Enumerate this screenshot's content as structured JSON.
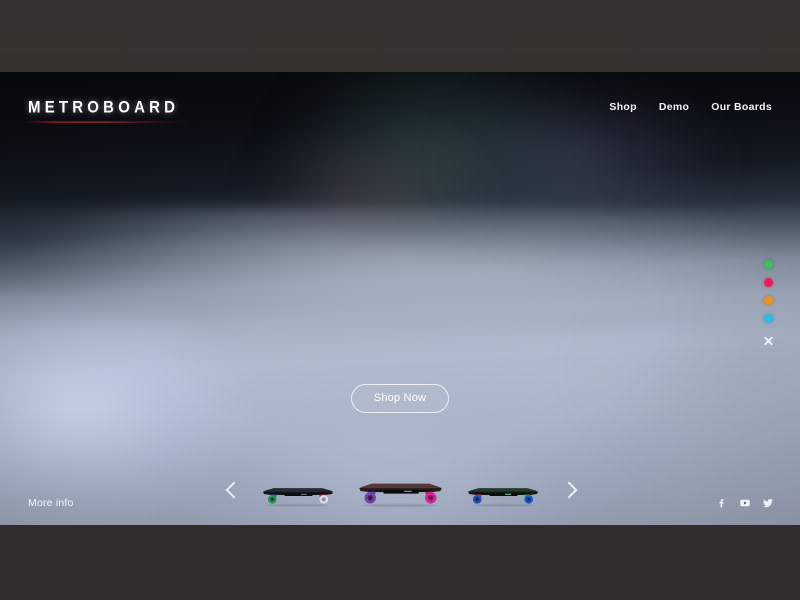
{
  "site": {
    "brand": "METROBOARD",
    "nav": [
      {
        "label": "Shop",
        "name": "nav-shop"
      },
      {
        "label": "Demo",
        "name": "nav-demo"
      },
      {
        "label": "Our Boards",
        "name": "nav-our-boards"
      }
    ],
    "hero": {
      "cta_label": "Shop Now"
    },
    "swatches": [
      {
        "name": "swatch-green",
        "color": "#3FBF5E"
      },
      {
        "name": "swatch-pink",
        "color": "#F5165B"
      },
      {
        "name": "swatch-orange",
        "color": "#F0911F"
      },
      {
        "name": "swatch-cyan",
        "color": "#29BEEA"
      }
    ],
    "close_icon": "close-icon",
    "carousel": {
      "prev_icon": "chevron-left-icon",
      "next_icon": "chevron-right-icon",
      "boards": [
        {
          "name": "board-thumb-1",
          "deck": "#14171d",
          "deck_top": "#1f242c",
          "wheel_front": "#2f8f5f",
          "wheel_rear": "#d8dde5",
          "truck_front": "#2b62b4",
          "truck_rear": "#c8233f",
          "scale": 0.82
        },
        {
          "name": "board-thumb-2",
          "deck": "#2a1d1c",
          "deck_top": "#4a3230",
          "wheel_front": "#7a3fa8",
          "wheel_rear": "#d6249a",
          "truck_front": "#2d4fb0",
          "truck_rear": "#b9203c",
          "scale": 1.0
        },
        {
          "name": "board-thumb-3",
          "deck": "#131a17",
          "deck_top": "#1d2b24",
          "wheel_front": "#2452b8",
          "wheel_rear": "#1f59c4",
          "truck_front": "#d1267f",
          "truck_rear": "#2fb84c",
          "scale": 0.82
        }
      ]
    },
    "footer": {
      "more_info_label": "More info",
      "social": [
        {
          "name": "facebook-icon",
          "label": "f"
        },
        {
          "name": "youtube-icon",
          "label": "YouTube"
        },
        {
          "name": "twitter-icon",
          "label": "Twitter"
        }
      ]
    }
  }
}
